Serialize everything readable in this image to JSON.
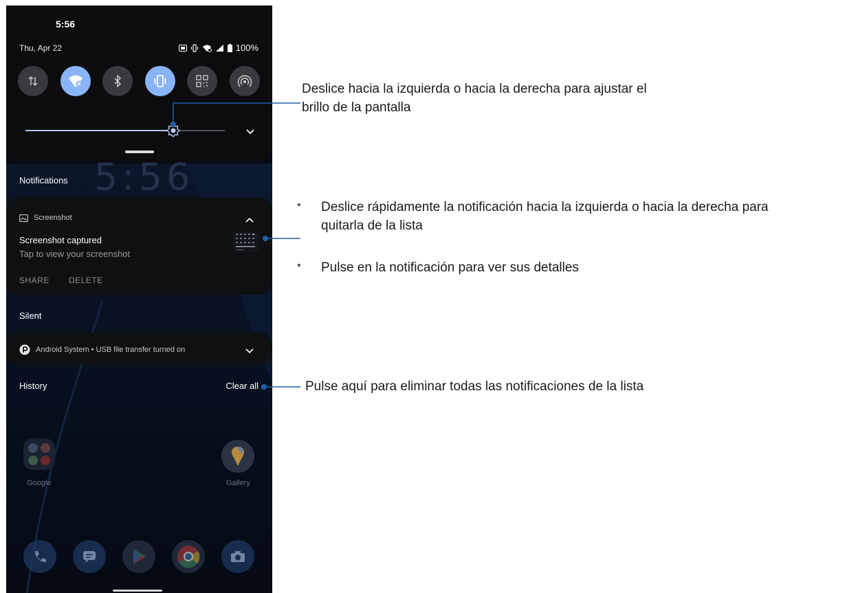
{
  "status_bar": {
    "time": "5:56",
    "date": "Thu, Apr 22",
    "battery": "100%"
  },
  "quick_settings": {
    "tiles": [
      {
        "icon": "mobile-data-icon",
        "on": false
      },
      {
        "icon": "wifi-icon",
        "on": true
      },
      {
        "icon": "bluetooth-icon",
        "on": false
      },
      {
        "icon": "vibrate-icon",
        "on": true
      },
      {
        "icon": "qr-scanner-icon",
        "on": false
      },
      {
        "icon": "hotspot-icon",
        "on": false
      }
    ],
    "brightness_level": 0.74
  },
  "background_clock": "5:56",
  "notifications": {
    "header": "Notifications",
    "screenshot": {
      "app_name": "Screenshot",
      "title": "Screenshot captured",
      "text": "Tap to view your screenshot",
      "actions": [
        "SHARE",
        "DELETE"
      ]
    },
    "silent_header": "Silent",
    "silent_item": "Android System • USB file transfer turned on",
    "history_label": "History",
    "clear_all": "Clear all"
  },
  "home": {
    "apps": [
      {
        "label": "Google"
      },
      {
        "label": "Gallery"
      }
    ]
  },
  "annotations": {
    "brightness": [
      "Deslice hacia la izquierda o hacia la derecha para ajustar el",
      "brillo de la pantalla"
    ],
    "swipe": [
      "Deslice rápidamente la notificación hacia la izquierda o hacia la derecha para",
      "quitarla de la lista"
    ],
    "tap": "Pulse en la notificación para ver sus detalles",
    "clear": "Pulse aquí para eliminar todas las notificaciones de la lista"
  },
  "colors": {
    "accent": "#8ab4f8",
    "callout_line": "#1f5fa8",
    "shade": "#0c0c0e"
  }
}
